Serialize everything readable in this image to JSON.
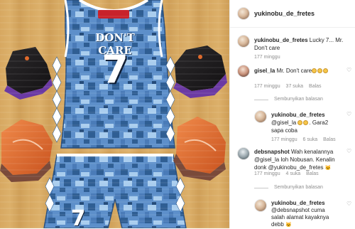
{
  "header": {
    "username": "yukinobu_de_fretes"
  },
  "caption": {
    "username": "yukinobu_de_fretes",
    "text": " Lucky 7... Mr. Don't care",
    "time": "177 minggu"
  },
  "comment1": {
    "username": "gisel_la",
    "text": " Mr. Don't care",
    "emoji_tail": "😂😂😂",
    "time": "177 minggu",
    "likes": "37 suka",
    "reply": "Balas",
    "hide_replies": "Sembunyikan balasan"
  },
  "reply1": {
    "username": "yukinobu_de_fretes",
    "text": " @gisel_la 😂😂. Gara2 sapa coba",
    "line1": "@gisel_la",
    "line1_tail": ". Gara2",
    "line2": "sapa coba",
    "time": "177 minggu",
    "likes": "6 suka",
    "reply": "Balas"
  },
  "comment2": {
    "username": "debsnapshot",
    "line1": " Wah kenalannya",
    "line2": "@gisel_la loh Nobusan. Kenalin",
    "line3": "donk @yukinobu_de_fretes",
    "time": "177 minggu",
    "likes": "4 suka",
    "reply": "Balas",
    "hide_replies": "Sembunyikan balasan"
  },
  "reply2": {
    "username": "yukinobu_de_fretes",
    "line1": "@debsnapshot cuma",
    "line2": "salah alamat kayaknya",
    "line3": "debb"
  },
  "jersey": {
    "top_text": "DON'T CARE",
    "number": "7",
    "short_number": "7"
  },
  "colors": {
    "camo_dark": "#2f5e93",
    "camo_mid": "#5d8fca",
    "camo_light": "#a9cdee",
    "sneaker_black": "#1d1b1d",
    "sneaker_purple": "#6b3aa3",
    "sneaker_orange": "#e06a2c",
    "floor": "#d7a861"
  }
}
